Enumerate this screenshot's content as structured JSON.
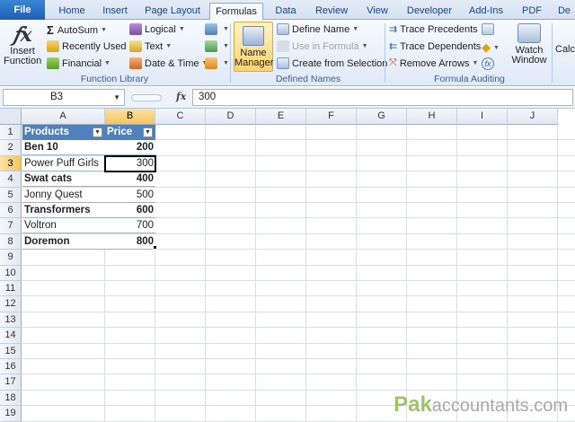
{
  "ribbon_tabs": [
    "File",
    "Home",
    "Insert",
    "Page Layout",
    "Formulas",
    "Data",
    "Review",
    "View",
    "Developer",
    "Add-Ins",
    "PDF",
    "De"
  ],
  "active_tab": "Formulas",
  "function_library": {
    "insert_function": [
      "Insert",
      "Function"
    ],
    "autosum": "AutoSum",
    "recently_used": "Recently Used",
    "financial": "Financial",
    "logical": "Logical",
    "text": "Text",
    "date_time": "Date & Time",
    "label": "Function Library"
  },
  "defined_names": {
    "name_manager": [
      "Name",
      "Manager"
    ],
    "define_name": "Define Name",
    "use_in_formula": "Use in Formula",
    "create_from_selection": "Create from Selection",
    "label": "Defined Names"
  },
  "formula_auditing": {
    "trace_precedents": "Trace Precedents",
    "trace_dependents": "Trace Dependents",
    "remove_arrows": "Remove Arrows",
    "watch_window": [
      "Watch",
      "Window"
    ],
    "label": "Formula Auditing"
  },
  "calculation": {
    "label_partial": "Calcu"
  },
  "formula_bar": {
    "name_box": "B3",
    "fx": "fx",
    "value": "300"
  },
  "columns": [
    "A",
    "B",
    "C",
    "D",
    "E",
    "F",
    "G",
    "H",
    "I",
    "J"
  ],
  "rows": [
    "1",
    "2",
    "3",
    "4",
    "5",
    "6",
    "7",
    "8",
    "9",
    "10",
    "11",
    "12",
    "13",
    "14",
    "15",
    "16",
    "17",
    "18",
    "19"
  ],
  "table": {
    "headers": [
      "Products",
      "Price"
    ],
    "rows": [
      [
        "Ben 10",
        "200"
      ],
      [
        "Power Puff Girls",
        "300"
      ],
      [
        "Swat cats",
        "400"
      ],
      [
        "Jonny Quest",
        "500"
      ],
      [
        "Transformers",
        "600"
      ],
      [
        "Voltron",
        "700"
      ],
      [
        "Doremon",
        "800"
      ]
    ]
  },
  "watermark": {
    "brand": "Pak",
    "suffix": "accountants.com"
  },
  "colors": {
    "table_header": "#4f81bd",
    "file_tab": "#1e5fb3",
    "selection_header": "#f5c55c"
  }
}
